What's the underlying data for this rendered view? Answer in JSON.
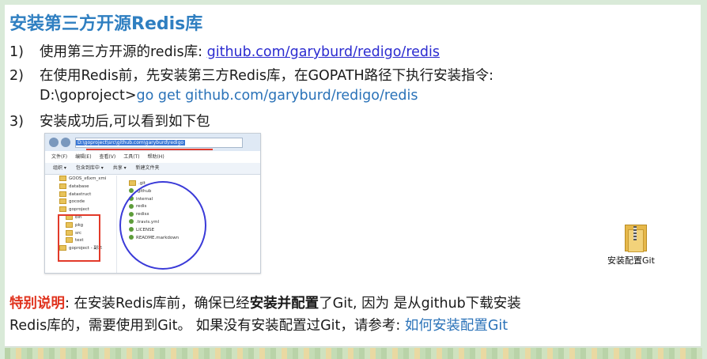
{
  "title": "安装第三方开源Redis库",
  "steps": [
    {
      "num": "1)",
      "text": "使用第三方开源的redis库: ",
      "link": "github.com/garyburd/redigo/redis"
    },
    {
      "num": "2)",
      "text": "在使用Redis前，先安装第三方Redis库，在GOPATH路径下执行安装指令:"
    },
    {
      "prompt": "D:\\goproject>",
      "command": "go get github.com/garyburd/redigo/redis"
    },
    {
      "num": "3)",
      "text": "安装成功后,可以看到如下包"
    }
  ],
  "explorer": {
    "address": "D:\\goproject\\src\\github.com\\garyburd\\redigo",
    "menu": [
      "文件(F)",
      "编辑(E)",
      "查看(V)",
      "工具(T)",
      "帮助(H)"
    ],
    "toolbar": [
      "组织 ▾",
      "包含到库中 ▾",
      "共享 ▾",
      "新建文件夹"
    ],
    "tree": [
      "GOOS_x6xm_xmi",
      "database",
      "datastruct",
      "gocode",
      "goproject",
      "bin",
      "pkg",
      "src",
      "test",
      "goproject - 副本"
    ],
    "files": [
      ".git",
      ".github",
      "internal",
      "redis",
      "redisx",
      ".travis.yml",
      "LICENSE",
      "README.markdown"
    ]
  },
  "desktop_icon": {
    "label": "安装配置Git",
    "icon": "zip-folder-icon"
  },
  "note": {
    "label": "特别说明",
    "p1": ": 在安装Redis库前，确保已经",
    "bold": "安装并配置",
    "p2": "了Git, 因为 是从github下载安装",
    "line2": "Redis库的，需要使用到Git。 如果没有安装配置过Git，请参考: ",
    "link": "如何安装配置Git"
  }
}
